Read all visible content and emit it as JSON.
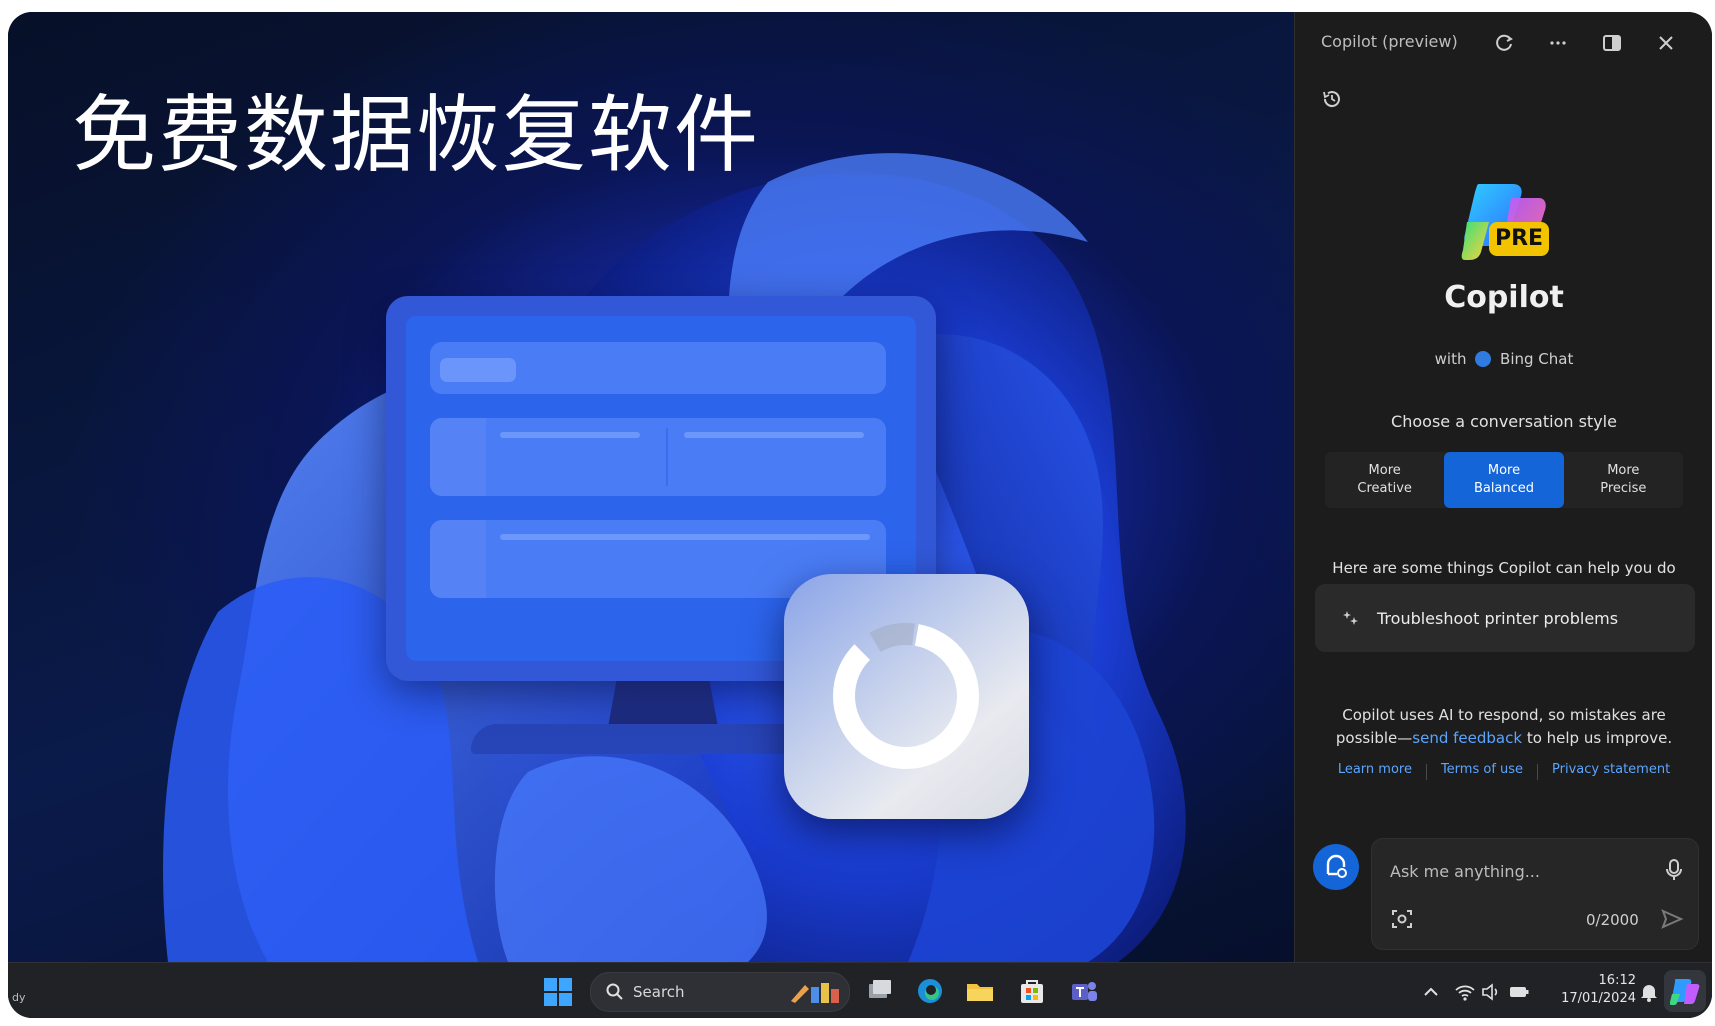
{
  "headline": "免费数据恢复软件",
  "copilot": {
    "window_title": "Copilot (preview)",
    "logo_badge": "PRE",
    "app_name": "Copilot",
    "with_prefix": "with",
    "with_product": "Bing Chat",
    "style_prompt": "Choose a conversation style",
    "styles": [
      {
        "line1": "More",
        "line2": "Creative",
        "selected": false
      },
      {
        "line1": "More",
        "line2": "Balanced",
        "selected": true
      },
      {
        "line1": "More",
        "line2": "Precise",
        "selected": false
      }
    ],
    "help_prompt": "Here are some things Copilot can help you do",
    "suggestion": "Troubleshoot printer problems",
    "disclaimer_part1": "Copilot uses AI to respond, so mistakes are possible—",
    "disclaimer_link": "send feedback",
    "disclaimer_part2": " to help us improve.",
    "links": [
      "Learn more",
      "Terms of use",
      "Privacy statement"
    ],
    "input_placeholder": "Ask me anything...",
    "char_count": "0/2000"
  },
  "taskbar": {
    "weather_fragment": "dy",
    "search_label": "Search",
    "time": "16:12",
    "date": "17/01/2024"
  },
  "colors": {
    "accent_blue": "#1466d8",
    "panel_bg": "#1c1c1c",
    "link_blue": "#5aa5ff",
    "pre_badge": "#f2c400"
  },
  "icons": {
    "panel_controls": [
      "refresh-icon",
      "more-icon",
      "split-view-icon",
      "close-icon"
    ],
    "history": "history-icon",
    "suggestion": "sparkle-icon",
    "input": [
      "microphone-icon",
      "image-scan-icon",
      "send-icon"
    ],
    "taskbar_apps": [
      "task-view-icon",
      "edge-icon",
      "file-explorer-icon",
      "microsoft-store-icon",
      "teams-icon"
    ],
    "tray": [
      "chevron-up-icon",
      "wifi-icon",
      "volume-icon",
      "battery-icon",
      "notification-bell-icon"
    ]
  }
}
